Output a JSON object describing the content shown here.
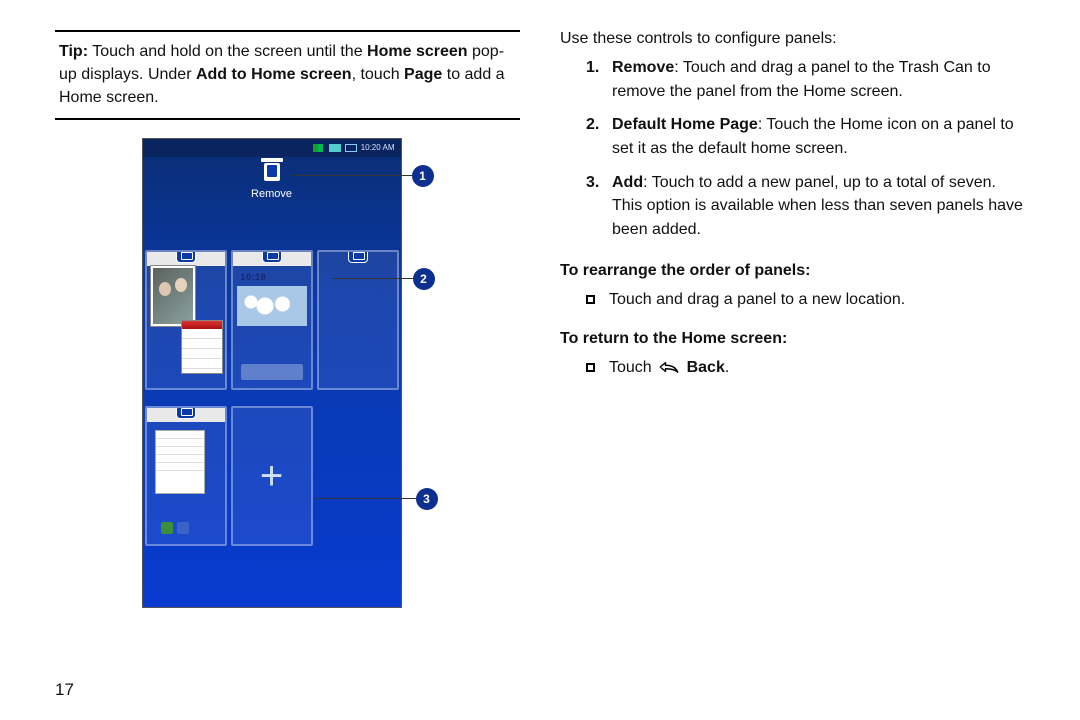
{
  "left": {
    "tip_label": "Tip:",
    "tip_part1": " Touch and hold on the screen until the ",
    "tip_bold1": "Home screen",
    "tip_part2": " pop-up displays. Under ",
    "tip_bold2": "Add to Home screen",
    "tip_part3": ", touch ",
    "tip_bold3": "Page",
    "tip_part4": " to add a Home screen.",
    "phone": {
      "time": "10:20 AM",
      "remove": "Remove",
      "panel2_clock": "10:18"
    },
    "callouts": {
      "c1": "1",
      "c2": "2",
      "c3": "3"
    },
    "page_number": "17"
  },
  "right": {
    "intro": "Use these controls to configure panels:",
    "items": [
      {
        "n": "1.",
        "bold": "Remove",
        "rest": ": Touch and drag a panel to the Trash Can to remove the panel from the Home screen."
      },
      {
        "n": "2.",
        "bold": "Default Home Page",
        "rest": ": Touch the Home icon on a panel to set it as the default home screen."
      },
      {
        "n": "3.",
        "bold": "Add",
        "rest": ": Touch to add a new panel, up to a total of seven. This option is available when less than seven panels have been added."
      }
    ],
    "sub1": "To rearrange the order of panels:",
    "bullet1": "Touch and drag a panel to a new location.",
    "sub2": "To return to the Home screen:",
    "bullet2_pre": "Touch ",
    "bullet2_bold": "Back",
    "bullet2_post": "."
  }
}
